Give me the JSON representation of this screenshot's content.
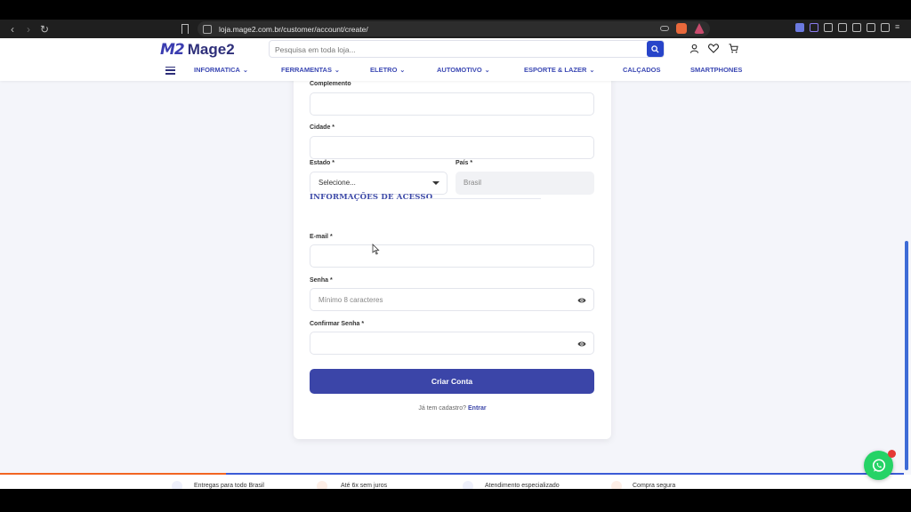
{
  "browser": {
    "url": "loja.mage2.com.br/customer/account/create/"
  },
  "site": {
    "logo_mark": "M2",
    "logo_text": "Mage2",
    "search_placeholder": "Pesquisa em toda loja...",
    "menu": [
      "INFORMATICA",
      "FERRAMENTAS",
      "ELETRO",
      "AUTOMOTIVO",
      "ESPORTE & LAZER",
      "CALÇADOS",
      "SMARTPHONES"
    ]
  },
  "form": {
    "complemento_label": "Complemento",
    "cidade_label": "Cidade *",
    "estado_label": "Estado *",
    "estado_value": "Selecione...",
    "pais_label": "País *",
    "pais_value": "Brasil",
    "section_title": "INFORMAÇÕES DE ACESSO",
    "email_label": "E-mail *",
    "senha_label": "Senha *",
    "senha_placeholder": "Mínimo 8 caracteres",
    "confirmar_label": "Confirmar Senha *",
    "submit_label": "Criar Conta",
    "login_prompt": "Já tem cadastro?",
    "login_link": "Entrar"
  },
  "footer": {
    "features": [
      "Entregas para todo Brasil",
      "Até 6x sem juros",
      "Atendimento especializado",
      "Compra segura"
    ]
  },
  "colors": {
    "primary": "#3b45a8",
    "accent_orange": "#f26522",
    "whatsapp": "#25d366"
  }
}
